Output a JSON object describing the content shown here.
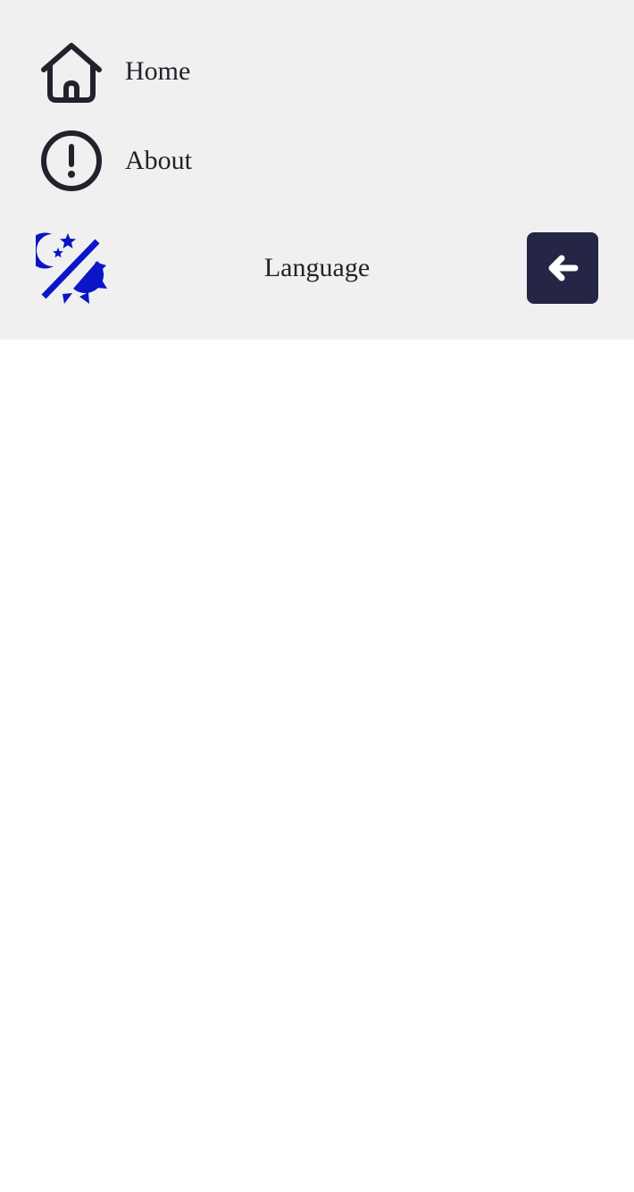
{
  "nav": {
    "items": [
      {
        "label": "Home",
        "icon": "home-icon"
      },
      {
        "label": "About",
        "icon": "info-exclamation-icon"
      }
    ]
  },
  "controls": {
    "theme_toggle_icon": "day-night-toggle-icon",
    "language_label": "Language",
    "close_icon": "arrow-left-icon"
  },
  "colors": {
    "panel_background": "#f0f0f0",
    "text": "#22222a",
    "theme_icon": "#0a16c8",
    "close_button_background": "#252645",
    "close_button_icon": "#ffffff",
    "page_background": "#ffffff"
  }
}
